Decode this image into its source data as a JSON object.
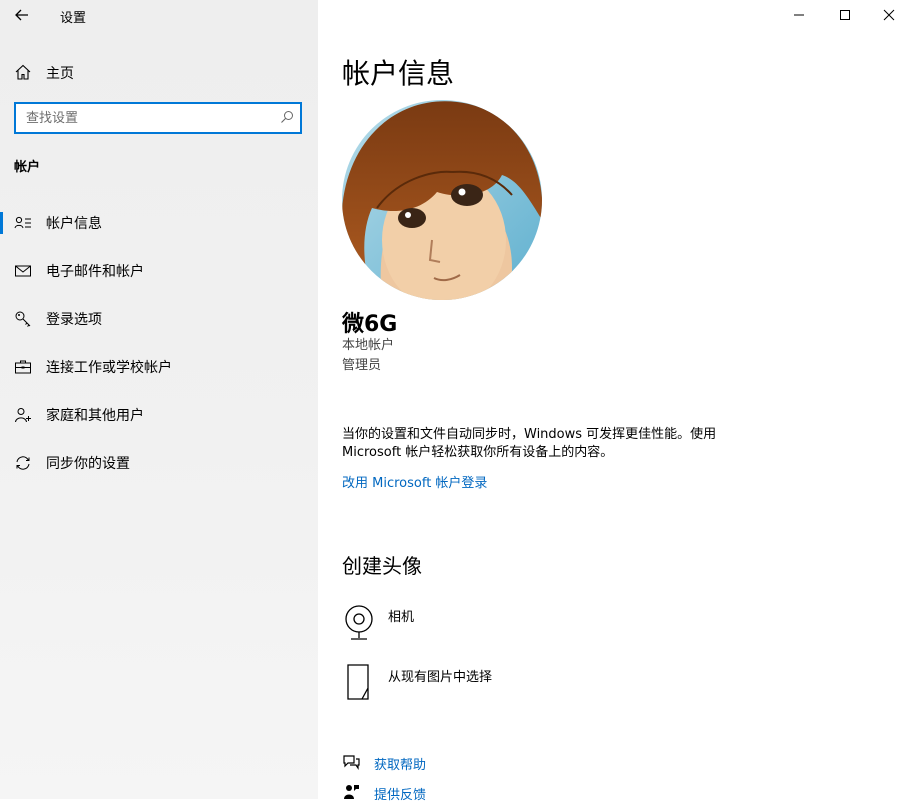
{
  "window": {
    "title": "设置"
  },
  "sidebar": {
    "home_label": "主页",
    "search": {
      "placeholder": "查找设置"
    },
    "section_title": "帐户",
    "items": [
      {
        "label": "帐户信息",
        "icon": "account-info-icon",
        "active": true
      },
      {
        "label": "电子邮件和帐户",
        "icon": "mail-icon",
        "active": false
      },
      {
        "label": "登录选项",
        "icon": "key-icon",
        "active": false
      },
      {
        "label": "连接工作或学校帐户",
        "icon": "briefcase-icon",
        "active": false
      },
      {
        "label": "家庭和其他用户",
        "icon": "add-person-icon",
        "active": false
      },
      {
        "label": "同步你的设置",
        "icon": "sync-icon",
        "active": false
      }
    ]
  },
  "main": {
    "title": "帐户信息",
    "user": {
      "name": "微6G",
      "account_type": "本地帐户",
      "role": "管理员"
    },
    "sync_description": "当你的设置和文件自动同步时，Windows 可发挥更佳性能。使用 Microsoft 帐户轻松获取你所有设备上的内容。",
    "ms_signin_link": "改用 Microsoft 帐户登录",
    "create_avatar": {
      "title": "创建头像",
      "options": [
        {
          "label": "相机",
          "icon": "camera-icon"
        },
        {
          "label": "从现有图片中选择",
          "icon": "browse-picture-icon"
        }
      ]
    },
    "help_links": [
      {
        "label": "获取帮助",
        "icon": "help-icon"
      },
      {
        "label": "提供反馈",
        "icon": "feedback-icon"
      }
    ]
  },
  "colors": {
    "accent": "#0078d7",
    "link": "#0067c0",
    "sidebar_bg": "#eeeeee"
  }
}
